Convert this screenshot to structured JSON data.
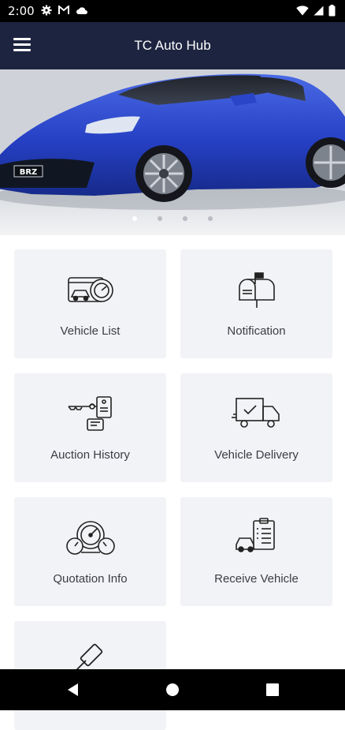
{
  "status_bar": {
    "time": "2:00",
    "icons_left": [
      "gear-icon",
      "gmail-icon",
      "cloud-icon"
    ],
    "icons_right": [
      "wifi-icon",
      "signal-icon",
      "battery-icon"
    ]
  },
  "app_bar": {
    "title": "TC Auto Hub",
    "menu_icon": "hamburger-menu-icon"
  },
  "banner": {
    "plate_text": "BRZ",
    "slide_count": 4,
    "active_slide": 1,
    "car_color": "#2f4fd0"
  },
  "menu_items": [
    {
      "label": "Vehicle List",
      "icon": "vehicle-list-icon"
    },
    {
      "label": "Notification",
      "icon": "mailbox-icon"
    },
    {
      "label": "Auction History",
      "icon": "key-tag-icon"
    },
    {
      "label": "Vehicle Delivery",
      "icon": "delivery-truck-icon"
    },
    {
      "label": "Quotation Info",
      "icon": "gauge-icon"
    },
    {
      "label": "Receive Vehicle",
      "icon": "receive-vehicle-icon"
    },
    {
      "label": "",
      "icon": "gavel-icon"
    }
  ],
  "nav_bar": {
    "buttons": [
      "back-icon",
      "home-icon",
      "recents-icon"
    ]
  },
  "colors": {
    "app_bar": "#1d2440",
    "card_bg": "#f2f3f6",
    "text": "#3a3d45"
  }
}
